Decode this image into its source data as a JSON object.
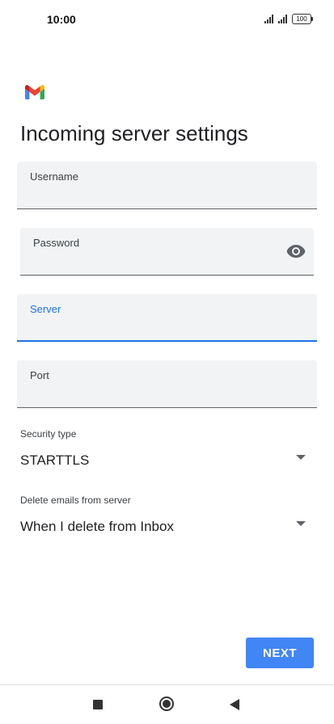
{
  "status_bar": {
    "time": "10:00",
    "battery": "100",
    "icons": [
      "signal-icon",
      "signal-icon",
      "battery-icon"
    ]
  },
  "logo": {
    "icon": "gmail-logo-icon",
    "colors": [
      "#4285f4",
      "#34a853",
      "#fbbc04",
      "#ea4335",
      "#c5221f"
    ]
  },
  "page": {
    "title": "Incoming server settings"
  },
  "fields": {
    "username": {
      "label": "Username",
      "value": ""
    },
    "password": {
      "label": "Password",
      "value": "",
      "icon": "eye-icon"
    },
    "server": {
      "label": "Server",
      "value": "",
      "focused": true
    },
    "port": {
      "label": "Port",
      "value": ""
    }
  },
  "security": {
    "label": "Security type",
    "value": "STARTTLS"
  },
  "delete_emails": {
    "label": "Delete emails from server",
    "value": "When I delete from Inbox"
  },
  "actions": {
    "next_label": "NEXT"
  },
  "navigation": {
    "icons": [
      "recents-icon",
      "home-icon",
      "back-icon"
    ]
  },
  "colors": {
    "accent": "#1a73e8",
    "button": "#4285f4",
    "field_bg": "#f1f3f4"
  }
}
